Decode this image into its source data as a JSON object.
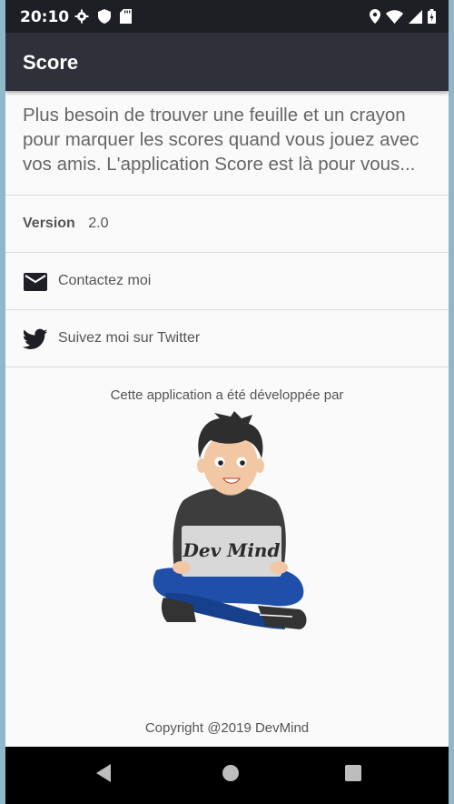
{
  "status_bar": {
    "time": "20:10",
    "left_icons": [
      "settings-icon",
      "shield-icon",
      "sd-card-icon"
    ],
    "right_icons": [
      "location-icon",
      "wifi-icon",
      "signal-icon",
      "battery-icon"
    ]
  },
  "app_bar": {
    "title": "Score"
  },
  "intro": {
    "text": "Plus besoin de trouver une feuille et un crayon pour marquer les scores quand vous jouez avec vos amis. L'application Score est là pour vous..."
  },
  "version": {
    "label": "Version",
    "value": "2.0"
  },
  "links": [
    {
      "label": "Contactez moi",
      "icon": "email-icon"
    },
    {
      "label": "Suivez moi sur Twitter",
      "icon": "twitter-icon"
    }
  ],
  "developer": {
    "caption": "Cette application a été développée par",
    "logo_text": "Dev Mind"
  },
  "footer": {
    "copyright": "Copyright @2019 DevMind"
  },
  "nav_bar": {
    "buttons": [
      "back-icon",
      "home-icon",
      "recents-icon"
    ]
  },
  "colors": {
    "app_bar": "#2f3039",
    "status_bar": "#1e1f24",
    "background": "#fafafa",
    "text": "#555555"
  }
}
